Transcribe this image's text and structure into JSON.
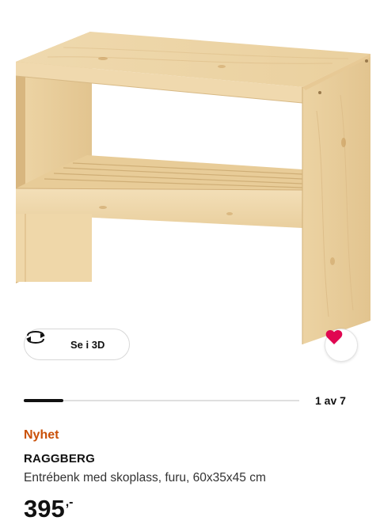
{
  "product": {
    "badge": "Nyhet",
    "name": "RAGGBERG",
    "description": "Entrébenk med skoplass, furu, 60x35x45 cm",
    "price_main": "395",
    "price_suffix": ",-",
    "image_alt": "RAGGBERG"
  },
  "viewer": {
    "view_3d_label": "Se i 3D",
    "view_3d_icon": "rotate-3d-icon",
    "favorite_icon": "heart-icon",
    "favorite_color": "#e00751"
  },
  "carousel": {
    "counter": "1 av 7",
    "current": 1,
    "total": 7,
    "progress_fraction": 0.1429
  },
  "colors": {
    "badge": "#ca5008",
    "text": "#111111",
    "wood_light": "#f2ddb3",
    "wood_mid": "#e6c995",
    "wood_dark": "#d2b07a"
  }
}
